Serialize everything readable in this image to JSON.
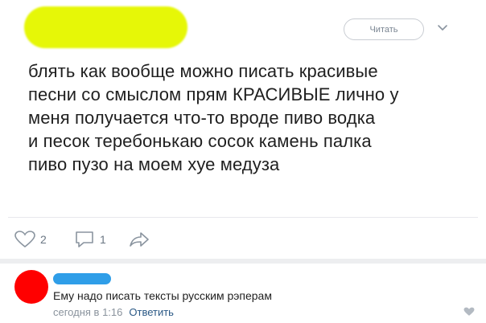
{
  "post": {
    "follow_label": "Читать",
    "text": "блять как вообще можно писать красивые\nпесни со смыслом прям КРАСИВЫЕ лично у\nменя получается что-то вроде пиво водка\nи песок теребонькаю сосок камень палка\nпиво пузо на моем хуе медуза",
    "likes": "2",
    "comments": "1"
  },
  "comment": {
    "text": "Ему надо писать тексты русским рэперам",
    "time": "сегодня в 1:16",
    "reply_label": "Ответить"
  },
  "icons": [
    "chevron-down-icon",
    "heart-icon",
    "comment-icon",
    "share-icon"
  ],
  "colors": {
    "name_redaction": "#e6f707",
    "avatar": "#ff0000",
    "commenter_redaction": "#2f9ee8",
    "link": "#2a5885"
  }
}
